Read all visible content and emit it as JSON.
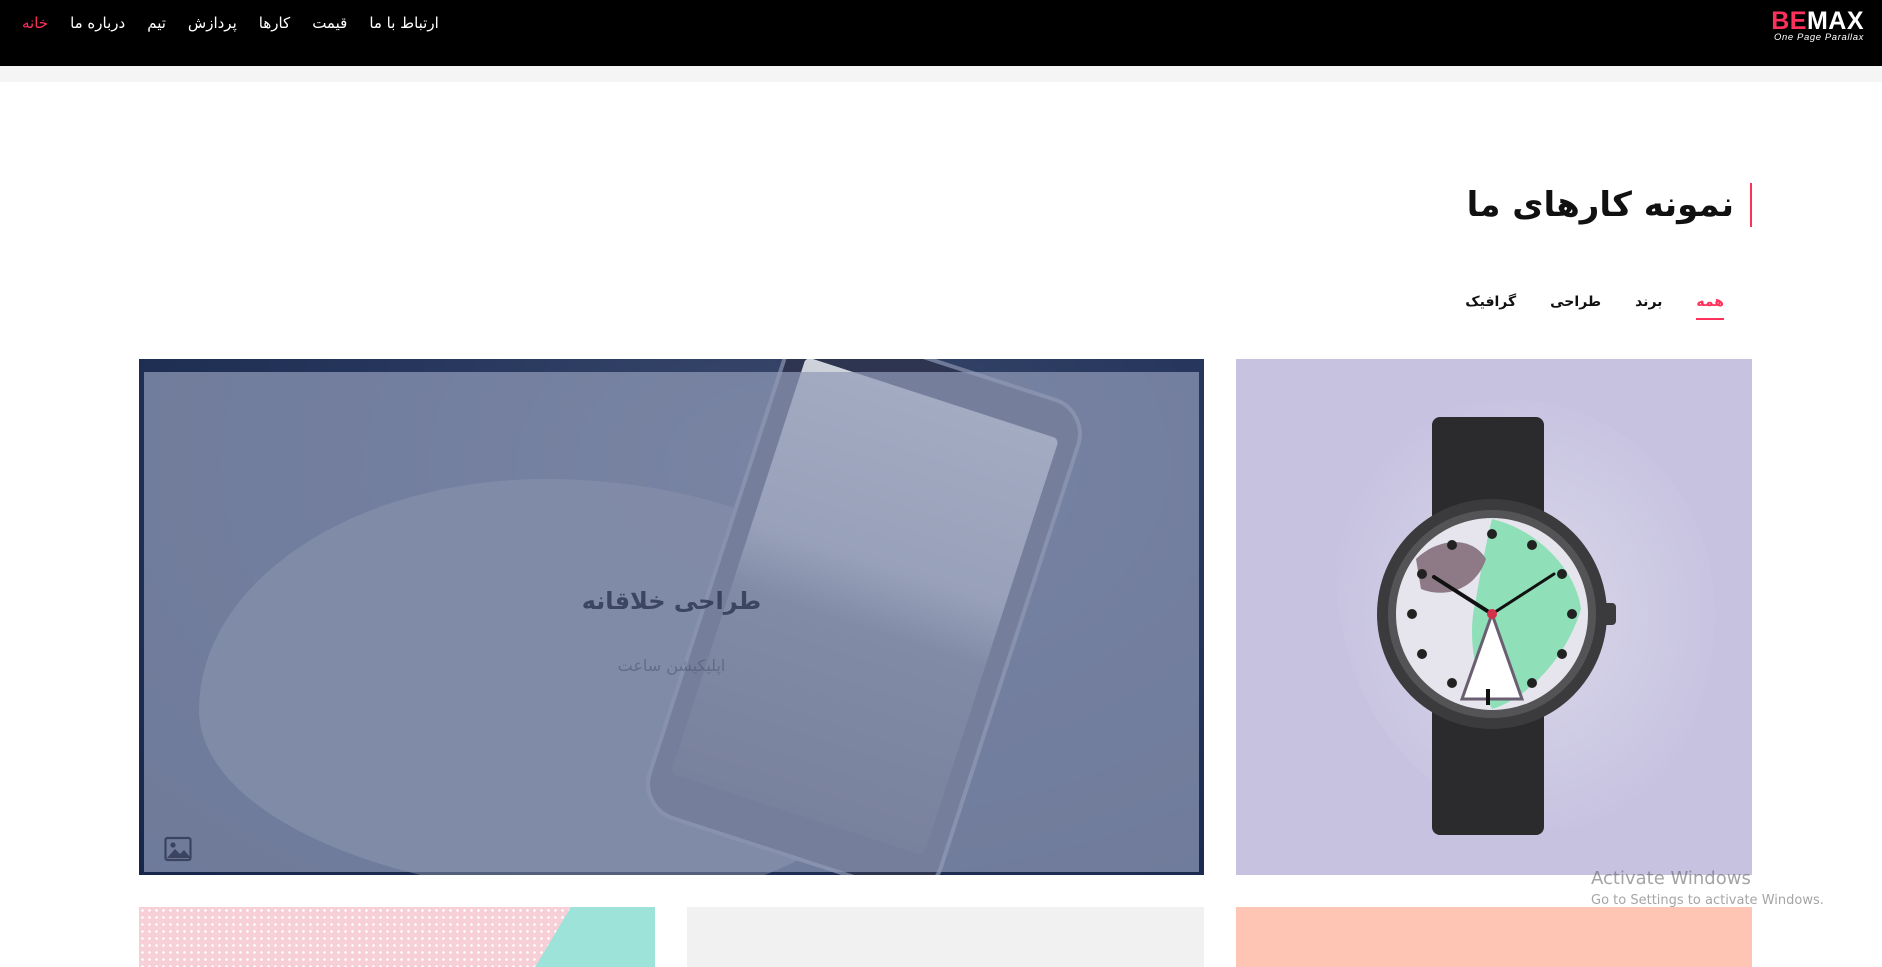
{
  "navbar": {
    "logo": {
      "be": "BE",
      "max": "MAX",
      "tagline": "One Page Parallax"
    },
    "links": [
      {
        "label": "خانه",
        "active": true
      },
      {
        "label": "درباره ما",
        "active": false
      },
      {
        "label": "تیم",
        "active": false
      },
      {
        "label": "پردازش",
        "active": false
      },
      {
        "label": "کارها",
        "active": false
      },
      {
        "label": "قیمت",
        "active": false
      },
      {
        "label": "ارتباط با ما",
        "active": false
      }
    ]
  },
  "portfolio": {
    "title": "نمونه کارهای ما",
    "filters": [
      {
        "label": "همه",
        "active": true
      },
      {
        "label": "برند",
        "active": false
      },
      {
        "label": "طراحی",
        "active": false
      },
      {
        "label": "گرافیک",
        "active": false
      }
    ],
    "featured_card": {
      "title": "طراحی خلاقانه",
      "subtitle": "اپلیکیشن ساعت",
      "icon": "image-icon"
    },
    "watch_card": {
      "icon": "watch-icon"
    }
  },
  "watermark": {
    "title": "Activate Windows",
    "subtitle": "Go to Settings to activate Windows."
  },
  "colors": {
    "accent": "#ff305b",
    "navbar_bg": "#000000",
    "watch_card_bg": "#c6c2e0",
    "salmon_card_bg": "#fec5b5"
  }
}
